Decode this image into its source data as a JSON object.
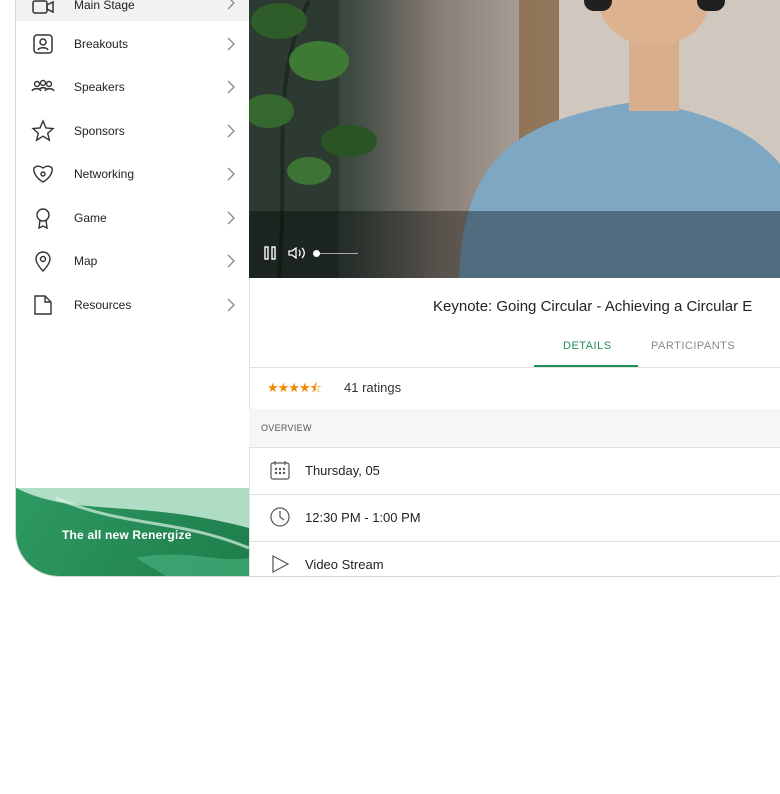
{
  "sidebar": {
    "items": [
      {
        "label": "Main Stage",
        "icon": "video-camera-icon"
      },
      {
        "label": "Breakouts",
        "icon": "person-frame-icon"
      },
      {
        "label": "Speakers",
        "icon": "people-group-icon"
      },
      {
        "label": "Sponsors",
        "icon": "star-icon"
      },
      {
        "label": "Networking",
        "icon": "networking-icon"
      },
      {
        "label": "Game",
        "icon": "award-icon"
      },
      {
        "label": "Map",
        "icon": "map-pin-icon"
      },
      {
        "label": "Resources",
        "icon": "document-icon"
      }
    ],
    "promo": "The all new Renergize"
  },
  "session": {
    "title": "Keynote: Going Circular - Achieving a Circular E",
    "tabs": {
      "details": "DETAILS",
      "participants": "PARTICIPANTS"
    },
    "rating": {
      "stars": 4.5,
      "max": 5,
      "text": "41 ratings"
    },
    "overview_label": "OVERVIEW",
    "info": {
      "date": "Thursday, 05",
      "time": "12:30 PM - 1:00 PM",
      "stream": "Video Stream"
    }
  },
  "video": {
    "progress": 0.1
  },
  "colors": {
    "accent": "#1f8f5a",
    "star": "#f08a00",
    "promo": "#2e9a62"
  }
}
